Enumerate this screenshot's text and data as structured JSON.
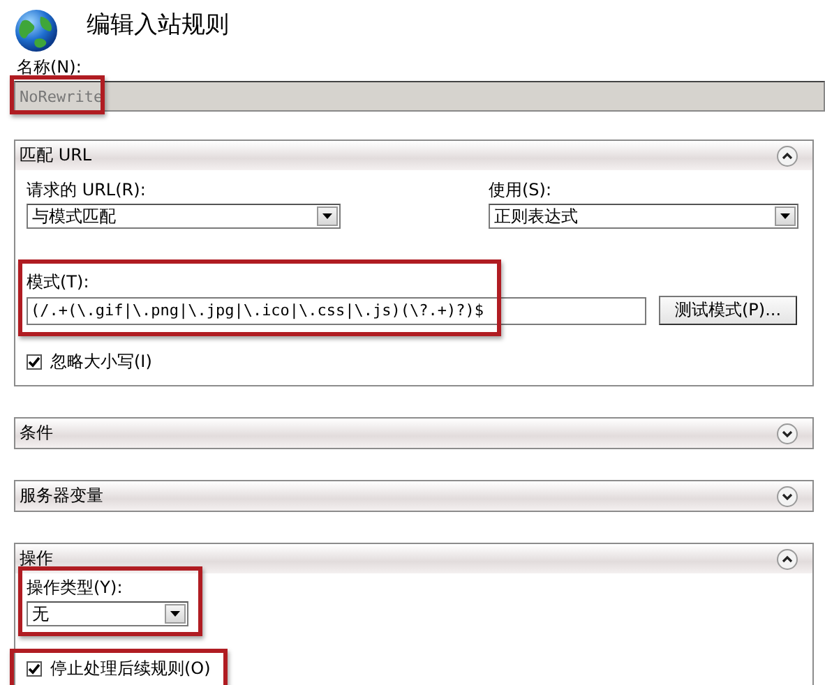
{
  "dialog": {
    "title": "编辑入站规则",
    "name_label": "名称(N):",
    "name_value": "NoRewrite",
    "name_disabled": true,
    "name_highlighted": true
  },
  "sections": [
    {
      "title": "匹配 URL",
      "expanded": true,
      "controls": [
        {
          "kind": "select_row",
          "items": [
            {
              "label": "请求的 URL(R):",
              "value": "与模式匹配"
            },
            {
              "label": "使用(S):",
              "value": "正则表达式"
            }
          ]
        },
        {
          "kind": "pattern",
          "label": "模式(T):",
          "value": "(/.+(\\.gif|\\.png|\\.jpg|\\.ico|\\.css|\\.js)(\\?.+)?)$",
          "button": "测试模式(P)...",
          "highlighted": true
        },
        {
          "kind": "checkbox",
          "label": "忽略大小写(I)",
          "checked": true,
          "highlighted": false
        }
      ]
    },
    {
      "title": "条件",
      "expanded": false
    },
    {
      "title": "服务器变量",
      "expanded": false
    },
    {
      "title": "操作",
      "expanded": true,
      "controls": [
        {
          "kind": "select",
          "label": "操作类型(Y):",
          "value": "无",
          "highlighted": true
        },
        {
          "kind": "checkbox",
          "label": "停止处理后续规则(O)",
          "checked": true,
          "highlighted": true
        }
      ]
    }
  ]
}
